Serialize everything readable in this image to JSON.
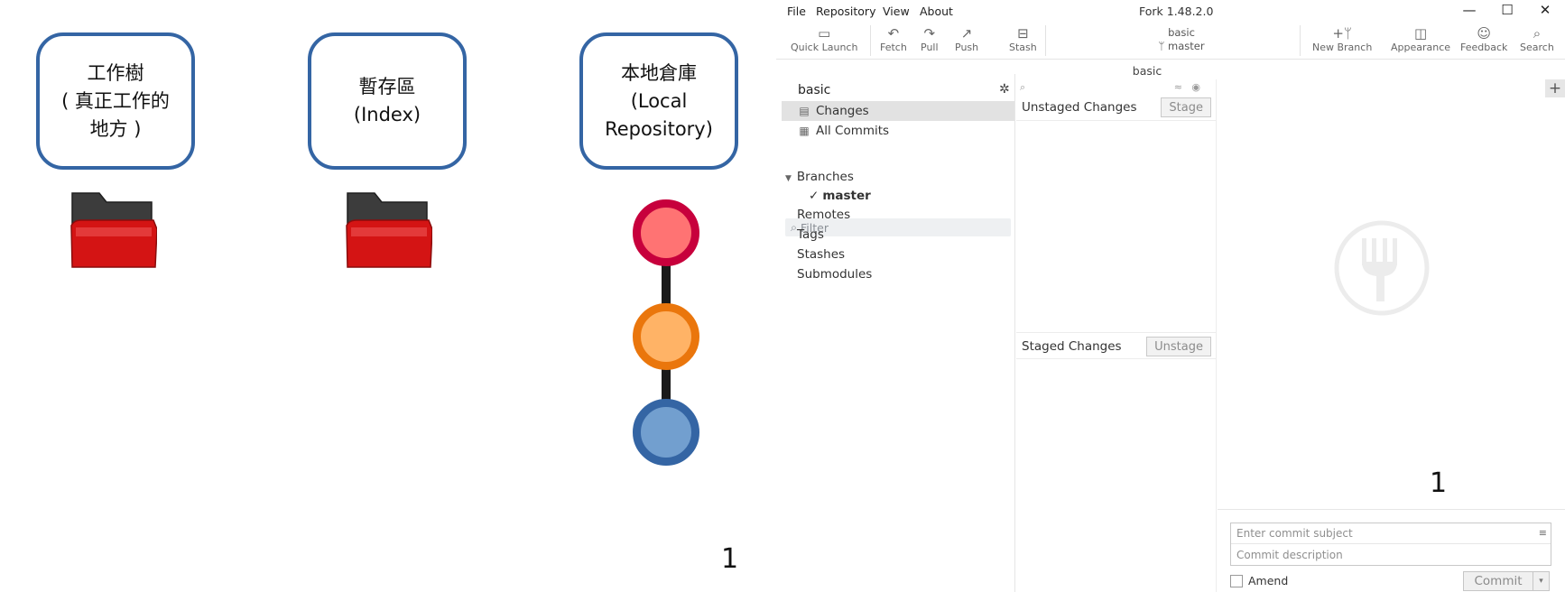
{
  "diagram": {
    "boxes": [
      {
        "line1": "工作樹",
        "line2": "( 真正工作的",
        "line3": "地方 )"
      },
      {
        "line1": "暫存區",
        "line2": "(Index)"
      },
      {
        "line1": "本地倉庫",
        "line2": "(Local",
        "line3": "Repository)"
      }
    ],
    "commit_colors": [
      {
        "fill": "#ff7373",
        "stroke": "#c7003c"
      },
      {
        "fill": "#ffb366",
        "stroke": "#ea760c"
      },
      {
        "fill": "#729fcf",
        "stroke": "#3465a4"
      }
    ],
    "folder_colors": {
      "back": "#3c3c3c",
      "front": "#d41414"
    },
    "page_number": "1"
  },
  "fork": {
    "menu": [
      "File",
      "Repository",
      "View",
      "About"
    ],
    "window_title": "Fork 1.48.2.0",
    "window_buttons": {
      "minimize": "—",
      "maximize": "☐",
      "close": "✕"
    },
    "toolbar": {
      "quick_launch": "Quick Launch",
      "fetch": "Fetch",
      "pull": "Pull",
      "push": "Push",
      "stash": "Stash",
      "repo_name": "basic",
      "branch": "master",
      "new_branch": "New Branch",
      "appearance": "Appearance",
      "feedback": "Feedback",
      "search": "Search"
    },
    "sidebar": {
      "repo_name": "basic",
      "changes": "Changes",
      "all_commits": "All Commits",
      "filter_placeholder": "Filter",
      "branches": "Branches",
      "current_branch": "master",
      "remotes": "Remotes",
      "tags": "Tags",
      "stashes": "Stashes",
      "submodules": "Submodules"
    },
    "content": {
      "repo_name": "basic",
      "unstaged_title": "Unstaged Changes",
      "stage_button": "Stage",
      "staged_title": "Staged Changes",
      "unstage_button": "Unstage",
      "page_number": "1",
      "commit_subject_placeholder": "Enter commit subject",
      "commit_description_placeholder": "Commit description",
      "amend_label": "Amend",
      "commit_button": "Commit"
    },
    "accent_colors": {
      "selected_row": "#e2e2e2",
      "filter_bg": "#eef0f2"
    }
  }
}
